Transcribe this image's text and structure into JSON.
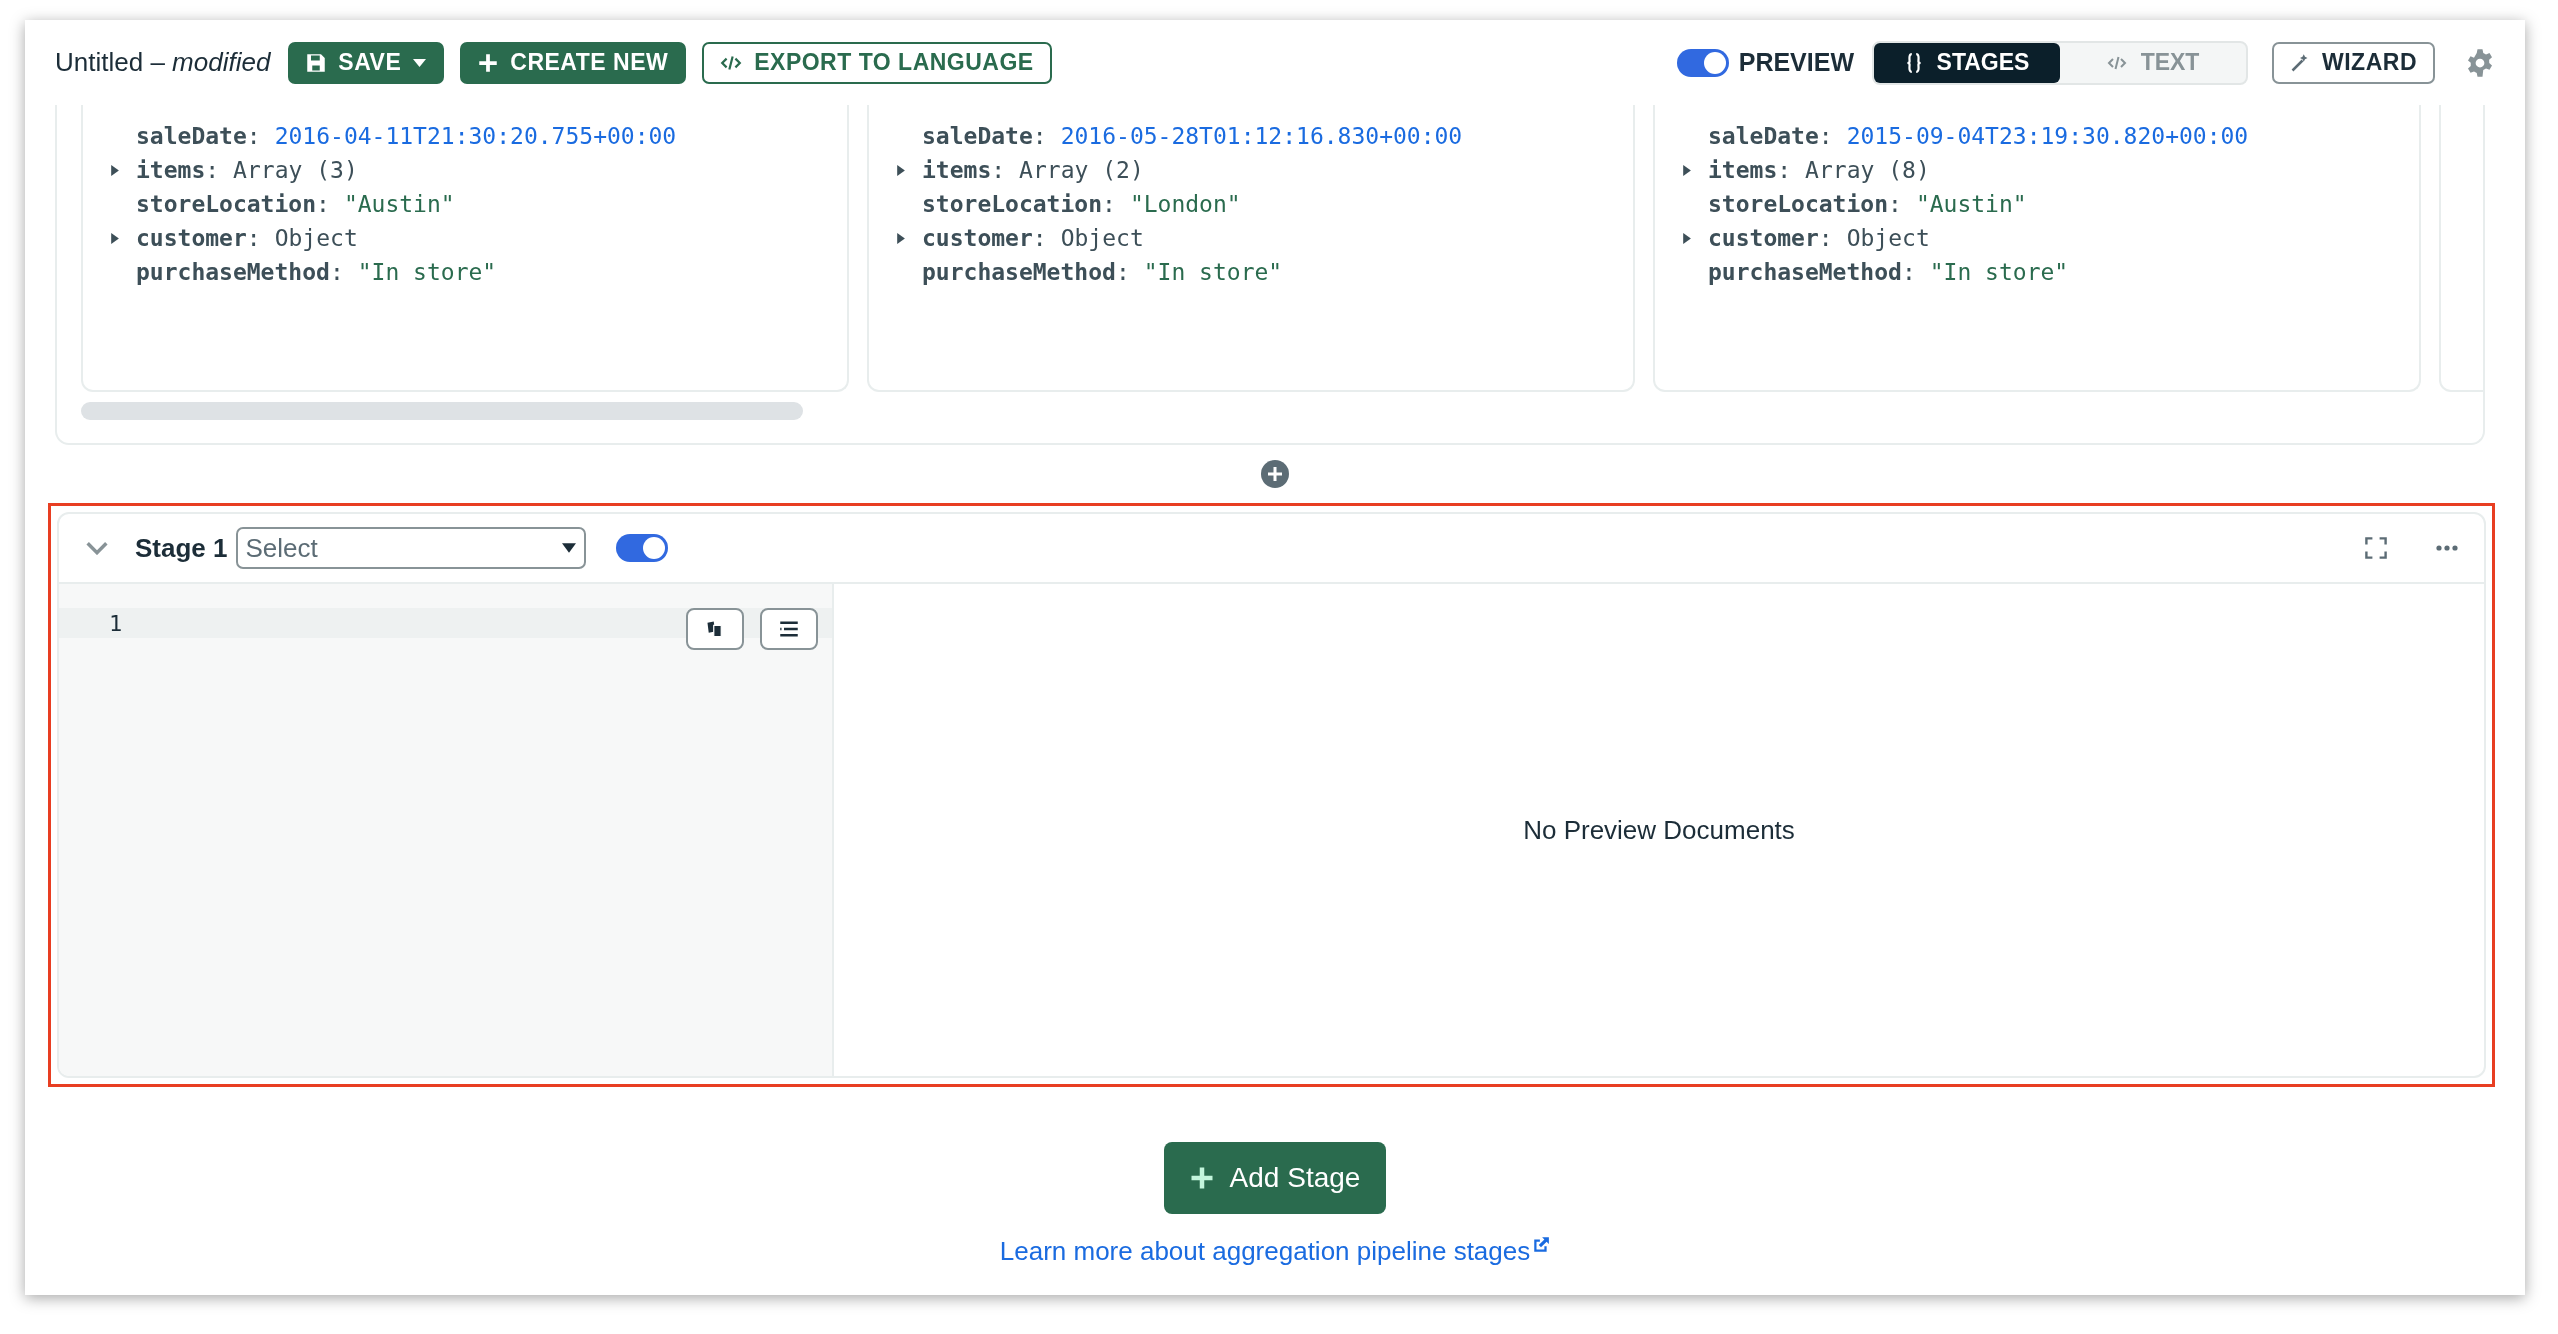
{
  "toolbar": {
    "title": "Untitled – *modified*",
    "actions": [
      {
        "kind": "save",
        "label": "SAVE"
      },
      {
        "kind": "create",
        "label": "CREATE NEW"
      },
      {
        "kind": "export",
        "label": "EXPORT TO LANGUAGE"
      }
    ],
    "preview": {
      "label": "PREVIEW",
      "on": true
    },
    "view_tabs": [
      {
        "kind": "stages",
        "label": "STAGES",
        "selected": true
      },
      {
        "kind": "text",
        "label": "TEXT",
        "selected": false
      }
    ],
    "wizard": {
      "label": "WIZARD"
    }
  },
  "documents": [
    {
      "fields": [
        {
          "key": "**saleDate**:",
          "value": "2016-04-11T21:30:20.755+00:00",
          "kind": "date"
        },
        {
          "key": "**items**:",
          "value": "Array (3)",
          "kind": "array",
          "expanded": false
        },
        {
          "key": "**storeLocation**:",
          "value": "\"Austin\"",
          "kind": "string"
        },
        {
          "key": "**customer**:",
          "value": "Object",
          "kind": "object",
          "expanded": false
        },
        {
          "key": "**purchaseMethod**:",
          "value": "\"In store\"",
          "kind": "string"
        }
      ]
    },
    {
      "fields": [
        {
          "key": "**saleDate**:",
          "value": "2016-05-28T01:12:16.830+00:00",
          "kind": "date"
        },
        {
          "key": "**items**:",
          "value": "Array (2)",
          "kind": "array",
          "expanded": false
        },
        {
          "key": "**storeLocation**:",
          "value": "\"London\"",
          "kind": "string"
        },
        {
          "key": "**customer**:",
          "value": "Object",
          "kind": "object",
          "expanded": false
        },
        {
          "key": "**purchaseMethod**:",
          "value": "\"In store\"",
          "kind": "string"
        }
      ]
    },
    {
      "fields": [
        {
          "key": "**saleDate**:",
          "value": "2015-09-04T23:19:30.820+00:00",
          "kind": "date"
        },
        {
          "key": "**items**:",
          "value": "Array (8)",
          "kind": "array",
          "expanded": false
        },
        {
          "key": "**storeLocation**:",
          "value": "\"Austin\"",
          "kind": "string"
        },
        {
          "key": "**customer**:",
          "value": "Object",
          "kind": "object",
          "expanded": false
        },
        {
          "key": "**purchaseMethod**:",
          "value": "\"In store\"",
          "kind": "string"
        }
      ]
    }
  ],
  "stage": {
    "label": "Stage 1",
    "select": {
      "placeholder": "Select"
    },
    "enabled": true,
    "expanded": true,
    "line_numbers": [
      "1"
    ],
    "preview_message": "No Preview Documents"
  },
  "add_stage": {
    "label": "Add Stage"
  },
  "learn_link": {
    "label": "Learn more about aggregation pipeline stages"
  }
}
